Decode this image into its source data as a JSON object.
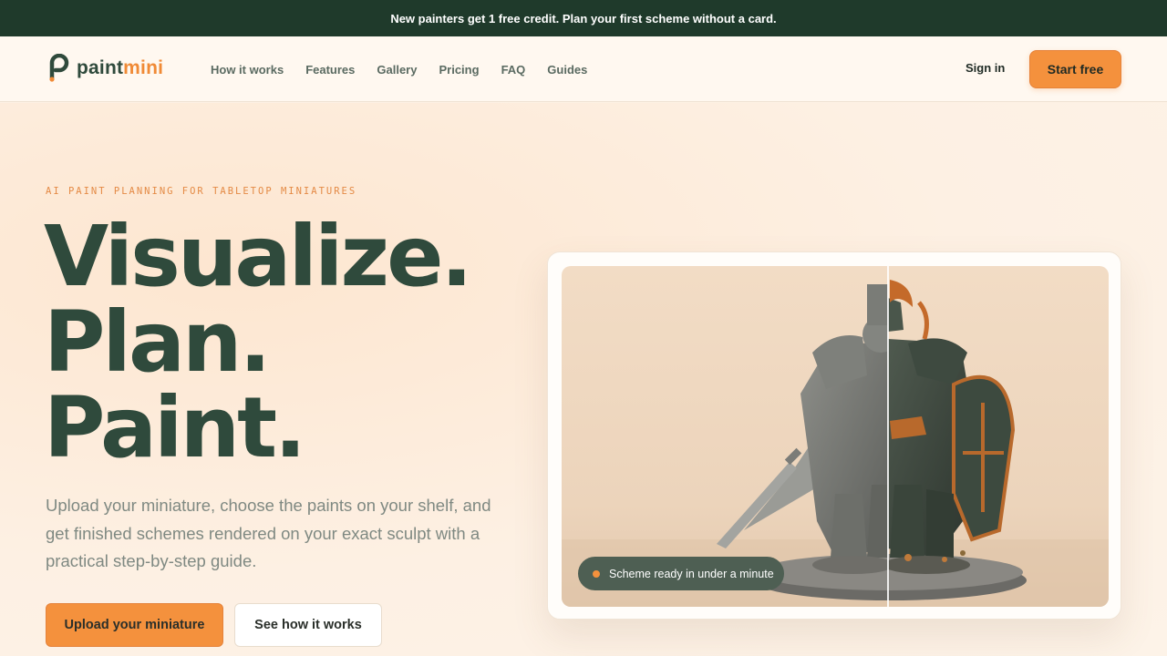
{
  "announcement": "New painters get 1 free credit. Plan your first scheme without a card.",
  "brand": {
    "name_part1": "paint",
    "name_part2": "mini",
    "accent_color": "#f08a36",
    "primary_color": "#2f4a3c"
  },
  "nav": {
    "links": [
      "How it works",
      "Features",
      "Gallery",
      "Pricing",
      "FAQ",
      "Guides"
    ],
    "sign_in": "Sign in",
    "cta": "Start free"
  },
  "hero": {
    "eyebrow": "AI PAINT PLANNING FOR TABLETOP MINIATURES",
    "headline": [
      "Visualize.",
      "Plan.",
      "Paint."
    ],
    "description": "Upload your miniature, choose the paints on your shelf, and get finished schemes rendered on your exact sculpt with a practical step-by-step guide.",
    "primary_button": "Upload your miniature",
    "secondary_button": "See how it works"
  },
  "preview": {
    "badge": "Scheme ready in under a minute"
  }
}
